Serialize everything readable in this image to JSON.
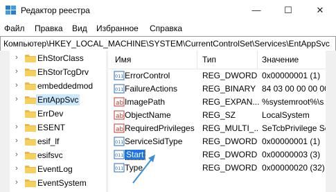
{
  "window": {
    "title": "Редактор реестра"
  },
  "title_buttons": {
    "minimize": "—",
    "maximize": "☐",
    "close": "✕"
  },
  "menu": [
    "Файл",
    "Правка",
    "Вид",
    "Избранное",
    "Справка"
  ],
  "address": "Компьютер\\HKEY_LOCAL_MACHINE\\SYSTEM\\CurrentControlSet\\Services\\EntAppSvc",
  "tree": {
    "items": [
      {
        "label": "EhStorClass",
        "expander": "›",
        "selected": false
      },
      {
        "label": "EhStorTcgDrv",
        "expander": "›",
        "selected": false
      },
      {
        "label": "embeddedmod",
        "expander": "›",
        "selected": false
      },
      {
        "label": "EntAppSvc",
        "expander": "›",
        "selected": true
      },
      {
        "label": "ErrDev",
        "expander": "",
        "selected": false
      },
      {
        "label": "ESENT",
        "expander": "›",
        "selected": false
      },
      {
        "label": "esif_lf",
        "expander": "›",
        "selected": false
      },
      {
        "label": "esifsvc",
        "expander": "›",
        "selected": false
      },
      {
        "label": "EventLog",
        "expander": "›",
        "selected": false
      },
      {
        "label": "EventSystem",
        "expander": "›",
        "selected": false
      }
    ]
  },
  "list": {
    "headers": {
      "name": "Имя",
      "type": "Тип",
      "data": "Значение"
    },
    "rows": [
      {
        "icon": "binary-value-icon",
        "name": "ErrorControl",
        "type": "REG_DWORD",
        "data": "0x00000001 (1)"
      },
      {
        "icon": "binary-value-icon",
        "name": "FailureActions",
        "type": "REG_BINARY",
        "data": "84 03 00 00 00 00"
      },
      {
        "icon": "string-value-icon",
        "name": "ImagePath",
        "type": "REG_EXPAN...",
        "data": "%systemroot%\\s"
      },
      {
        "icon": "string-value-icon",
        "name": "ObjectName",
        "type": "REG_SZ",
        "data": "LocalSystem"
      },
      {
        "icon": "string-value-icon",
        "name": "RequiredPrivileges",
        "type": "REG_MULTI_...",
        "data": "SeTcbPrivilege Se"
      },
      {
        "icon": "binary-value-icon",
        "name": "ServiceSidType",
        "type": "REG_DWORD",
        "data": "0x00000001 (1)"
      },
      {
        "icon": "binary-value-icon",
        "name": "Start",
        "type": "REG_DWORD",
        "data": "0x00000003 (3)",
        "highlighted": true
      },
      {
        "icon": "binary-value-icon",
        "name": "Type",
        "type": "REG_DWORD",
        "data": "0x00000020 (32)"
      }
    ]
  },
  "colors": {
    "selection": "#cce8ff",
    "highlight": "#1a73e8",
    "folder": "#e8b84a",
    "annotation_arrow": "#3a8fd8"
  }
}
